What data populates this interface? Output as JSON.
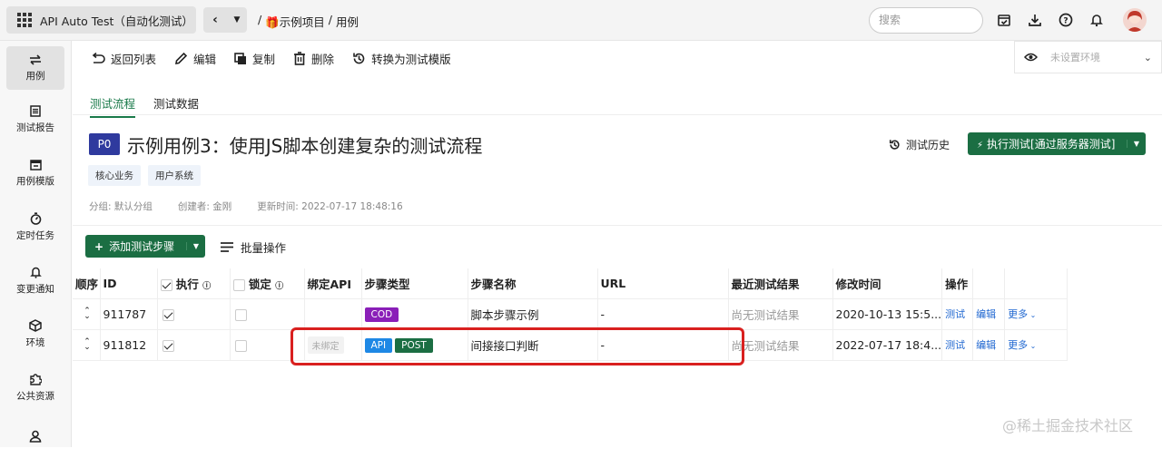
{
  "topbar": {
    "app_title": "API Auto Test（自动化测试）",
    "breadcrumb": [
      "/",
      "🎁示例项目",
      "/",
      "用例"
    ],
    "search_placeholder": "搜索"
  },
  "sidebar": {
    "items": [
      {
        "label": "用例",
        "icon": "swap-icon",
        "active": true
      },
      {
        "label": "测试报告",
        "icon": "report-icon"
      },
      {
        "label": "用例模版",
        "icon": "template-icon"
      },
      {
        "label": "定时任务",
        "icon": "timer-icon"
      },
      {
        "label": "变更通知",
        "icon": "bell-icon"
      },
      {
        "label": "环境",
        "icon": "cube-icon"
      },
      {
        "label": "公共资源",
        "icon": "puzzle-icon"
      },
      {
        "label": "",
        "icon": "user-icon"
      }
    ]
  },
  "toolbar": {
    "back": "返回列表",
    "edit": "编辑",
    "copy": "复制",
    "delete": "删除",
    "convert": "转换为测试模版"
  },
  "env_select": {
    "placeholder": "未设置环境"
  },
  "tabs": [
    "测试流程",
    "测试数据"
  ],
  "case": {
    "priority": "P0",
    "title": "示例用例3：使用JS脚本创建复杂的测试流程",
    "tags": [
      "核心业务",
      "用户系统"
    ],
    "group": "分组: 默认分组",
    "creator": "创建者: 金刚",
    "updated": "更新时间: 2022-07-17 18:48:16",
    "history_label": "测试历史",
    "run_label": "执行测试[通过服务器测试]"
  },
  "actions": {
    "add_step": "添加测试步骤",
    "batch": "批量操作"
  },
  "table": {
    "headers": {
      "order": "顺序",
      "id": "ID",
      "exec": "执行",
      "lock": "锁定",
      "bind": "绑定API",
      "type": "步骤类型",
      "name": "步骤名称",
      "url": "URL",
      "result": "最近测试结果",
      "mtime": "修改时间",
      "ops": "操作"
    },
    "rows": [
      {
        "id": "911787",
        "bind": "",
        "types": [
          "COD"
        ],
        "name": "脚本步骤示例",
        "url": "-",
        "result": "尚无测试结果",
        "mtime": "2020-10-13 15:5...",
        "op_test": "测试",
        "op_edit": "编辑",
        "op_more": "更多"
      },
      {
        "id": "911812",
        "bind": "未绑定",
        "types": [
          "API",
          "POST"
        ],
        "name": "间接接口判断",
        "url": "-",
        "result": "尚无测试结果",
        "mtime": "2022-07-17 18:4...",
        "op_test": "测试",
        "op_edit": "编辑",
        "op_more": "更多"
      }
    ]
  },
  "colors": {
    "primary": "#1b6e43",
    "priority": "#2f3a9e",
    "cod": "#8a1fb8",
    "api": "#1e88e5",
    "post": "#1b6e43",
    "highlight": "#d9201f"
  },
  "watermark": "@稀土掘金技术社区"
}
